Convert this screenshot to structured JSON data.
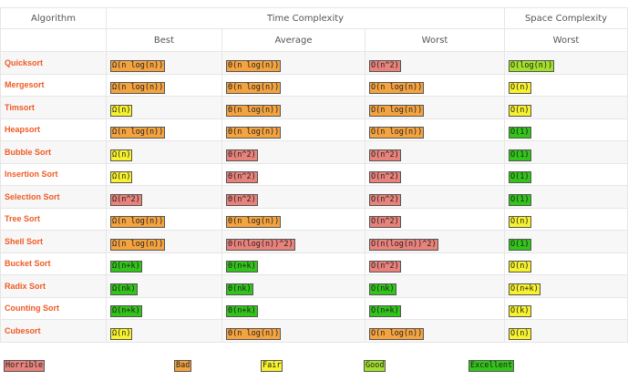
{
  "colors": {
    "horrible": "#e8827b",
    "bad": "#f5a33f",
    "fair": "#f7f22d",
    "good": "#a2e02a",
    "excellent": "#31c419",
    "algorithm_text": "#f15a24"
  },
  "header": {
    "algorithm": "Algorithm",
    "time_complexity": "Time Complexity",
    "space_complexity": "Space Complexity",
    "best": "Best",
    "average": "Average",
    "worst": "Worst",
    "space_worst": "Worst"
  },
  "rows": [
    {
      "name": "Quicksort",
      "best": {
        "text": "Ω(n log(n))",
        "rating": "bad"
      },
      "average": {
        "text": "Θ(n log(n))",
        "rating": "bad"
      },
      "worst": {
        "text": "O(n^2)",
        "rating": "horrible"
      },
      "space": {
        "text": "O(log(n))",
        "rating": "good"
      }
    },
    {
      "name": "Mergesort",
      "best": {
        "text": "Ω(n log(n))",
        "rating": "bad"
      },
      "average": {
        "text": "Θ(n log(n))",
        "rating": "bad"
      },
      "worst": {
        "text": "O(n log(n))",
        "rating": "bad"
      },
      "space": {
        "text": "O(n)",
        "rating": "fair"
      }
    },
    {
      "name": "Timsort",
      "best": {
        "text": "Ω(n)",
        "rating": "fair"
      },
      "average": {
        "text": "Θ(n log(n))",
        "rating": "bad"
      },
      "worst": {
        "text": "O(n log(n))",
        "rating": "bad"
      },
      "space": {
        "text": "O(n)",
        "rating": "fair"
      }
    },
    {
      "name": "Heapsort",
      "best": {
        "text": "Ω(n log(n))",
        "rating": "bad"
      },
      "average": {
        "text": "Θ(n log(n))",
        "rating": "bad"
      },
      "worst": {
        "text": "O(n log(n))",
        "rating": "bad"
      },
      "space": {
        "text": "O(1)",
        "rating": "excellent"
      }
    },
    {
      "name": "Bubble Sort",
      "best": {
        "text": "Ω(n)",
        "rating": "fair"
      },
      "average": {
        "text": "Θ(n^2)",
        "rating": "horrible"
      },
      "worst": {
        "text": "O(n^2)",
        "rating": "horrible"
      },
      "space": {
        "text": "O(1)",
        "rating": "excellent"
      }
    },
    {
      "name": "Insertion Sort",
      "best": {
        "text": "Ω(n)",
        "rating": "fair"
      },
      "average": {
        "text": "Θ(n^2)",
        "rating": "horrible"
      },
      "worst": {
        "text": "O(n^2)",
        "rating": "horrible"
      },
      "space": {
        "text": "O(1)",
        "rating": "excellent"
      }
    },
    {
      "name": "Selection Sort",
      "best": {
        "text": "Ω(n^2)",
        "rating": "horrible"
      },
      "average": {
        "text": "Θ(n^2)",
        "rating": "horrible"
      },
      "worst": {
        "text": "O(n^2)",
        "rating": "horrible"
      },
      "space": {
        "text": "O(1)",
        "rating": "excellent"
      }
    },
    {
      "name": "Tree Sort",
      "best": {
        "text": "Ω(n log(n))",
        "rating": "bad"
      },
      "average": {
        "text": "Θ(n log(n))",
        "rating": "bad"
      },
      "worst": {
        "text": "O(n^2)",
        "rating": "horrible"
      },
      "space": {
        "text": "O(n)",
        "rating": "fair"
      }
    },
    {
      "name": "Shell Sort",
      "best": {
        "text": "Ω(n log(n))",
        "rating": "bad"
      },
      "average": {
        "text": "Θ(n(log(n))^2)",
        "rating": "horrible"
      },
      "worst": {
        "text": "O(n(log(n))^2)",
        "rating": "horrible"
      },
      "space": {
        "text": "O(1)",
        "rating": "excellent"
      }
    },
    {
      "name": "Bucket Sort",
      "best": {
        "text": "Ω(n+k)",
        "rating": "excellent"
      },
      "average": {
        "text": "Θ(n+k)",
        "rating": "excellent"
      },
      "worst": {
        "text": "O(n^2)",
        "rating": "horrible"
      },
      "space": {
        "text": "O(n)",
        "rating": "fair"
      }
    },
    {
      "name": "Radix Sort",
      "best": {
        "text": "Ω(nk)",
        "rating": "excellent"
      },
      "average": {
        "text": "Θ(nk)",
        "rating": "excellent"
      },
      "worst": {
        "text": "O(nk)",
        "rating": "excellent"
      },
      "space": {
        "text": "O(n+k)",
        "rating": "fair"
      }
    },
    {
      "name": "Counting Sort",
      "best": {
        "text": "Ω(n+k)",
        "rating": "excellent"
      },
      "average": {
        "text": "Θ(n+k)",
        "rating": "excellent"
      },
      "worst": {
        "text": "O(n+k)",
        "rating": "excellent"
      },
      "space": {
        "text": "O(k)",
        "rating": "fair"
      }
    },
    {
      "name": "Cubesort",
      "best": {
        "text": "Ω(n)",
        "rating": "fair"
      },
      "average": {
        "text": "Θ(n log(n))",
        "rating": "bad"
      },
      "worst": {
        "text": "O(n log(n))",
        "rating": "bad"
      },
      "space": {
        "text": "O(n)",
        "rating": "fair"
      }
    }
  ],
  "legend": [
    {
      "label": "Horrible",
      "rating": "horrible"
    },
    {
      "label": "Bad",
      "rating": "bad"
    },
    {
      "label": "Fair",
      "rating": "fair"
    },
    {
      "label": "Good",
      "rating": "good"
    },
    {
      "label": "Excellent",
      "rating": "excellent"
    }
  ]
}
